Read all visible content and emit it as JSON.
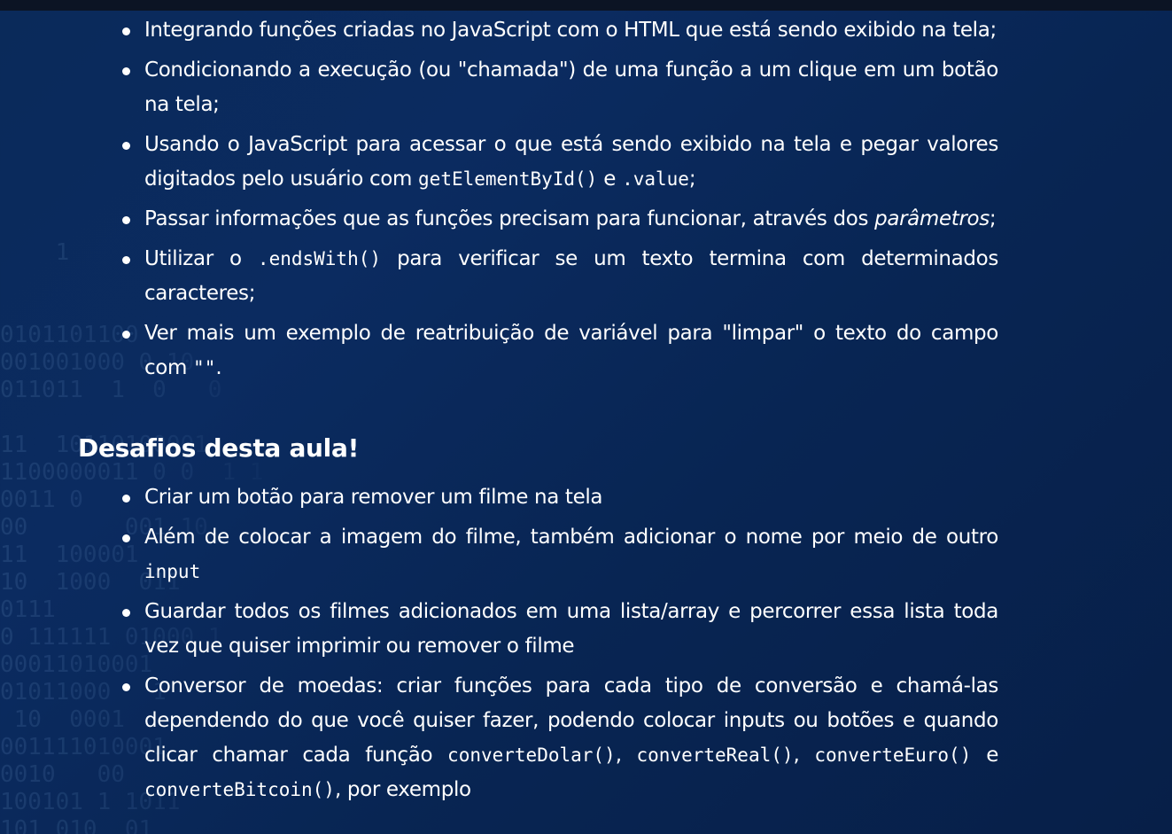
{
  "previous_list": {
    "items": [
      {
        "parts": [
          {
            "type": "text",
            "value": "Integrando funções criadas no JavaScript com o HTML que está sendo exibido na tela;"
          }
        ]
      },
      {
        "parts": [
          {
            "type": "text",
            "value": "Condicionando a execução (ou \"chamada\") de uma função a um clique em um botão na tela;"
          }
        ]
      },
      {
        "parts": [
          {
            "type": "text",
            "value": "Usando o JavaScript para acessar o que está sendo exibido na tela e pegar valores digitados pelo usuário com "
          },
          {
            "type": "code",
            "value": "getElementById()"
          },
          {
            "type": "text",
            "value": " e "
          },
          {
            "type": "code",
            "value": ".value"
          },
          {
            "type": "text",
            "value": ";"
          }
        ]
      },
      {
        "parts": [
          {
            "type": "text",
            "value": "Passar informações que as funções precisam para funcionar, através dos "
          },
          {
            "type": "em",
            "value": "parâmetros"
          },
          {
            "type": "text",
            "value": ";"
          }
        ]
      },
      {
        "parts": [
          {
            "type": "text",
            "value": "Utilizar o "
          },
          {
            "type": "code",
            "value": ".endsWith()"
          },
          {
            "type": "text",
            "value": " para verificar se um texto termina com determinados caracteres;"
          }
        ]
      },
      {
        "parts": [
          {
            "type": "text",
            "value": "Ver mais um exemplo de reatribuição de variável para \"limpar\" o texto do campo com "
          },
          {
            "type": "code",
            "value": "\"\""
          },
          {
            "type": "text",
            "value": "."
          }
        ]
      }
    ]
  },
  "challenges": {
    "heading": "Desafios desta aula!",
    "items": [
      {
        "parts": [
          {
            "type": "text",
            "value": "Criar um botão para remover um filme na tela"
          }
        ]
      },
      {
        "parts": [
          {
            "type": "text",
            "value": "Além de colocar a imagem do filme, também adicionar o nome por meio de outro "
          },
          {
            "type": "code",
            "value": "input"
          }
        ]
      },
      {
        "parts": [
          {
            "type": "text",
            "value": "Guardar todos os filmes adicionados em uma lista/array e percorrer essa lista toda vez que quiser imprimir ou remover o filme"
          }
        ]
      },
      {
        "parts": [
          {
            "type": "text",
            "value": "Conversor de moedas: criar funções para cada tipo de conversão e chamá-las dependendo do que você quiser fazer, podendo colocar inputs ou botões e quando clicar chamar cada função "
          },
          {
            "type": "code",
            "value": "converteDolar()"
          },
          {
            "type": "text",
            "value": ", "
          },
          {
            "type": "code",
            "value": "converteReal()"
          },
          {
            "type": "text",
            "value": ", "
          },
          {
            "type": "code",
            "value": "converteEuro()"
          },
          {
            "type": "text",
            "value": " e "
          },
          {
            "type": "code",
            "value": "converteBitcoin()"
          },
          {
            "type": "text",
            "value": ", por exemplo"
          }
        ]
      }
    ]
  },
  "background": {
    "binary_text": "    1\n\n\n0101101100\n001001000 0 10\n011011  1  0   0\n\n11  10110100001\n1100000011 0 0  1 1\n0011 0    \n00       001 10\n11  100001\n10  1000  011\n0111\n0 111111 01000 1\n00011010001\n01011000   1\n 10  0001\n001111010001\n0010   00\n100101 1 1011\n101 010  01"
  },
  "colors": {
    "background": "#0a2a5a",
    "topbar": "#0c1424",
    "text": "#ffffff"
  }
}
